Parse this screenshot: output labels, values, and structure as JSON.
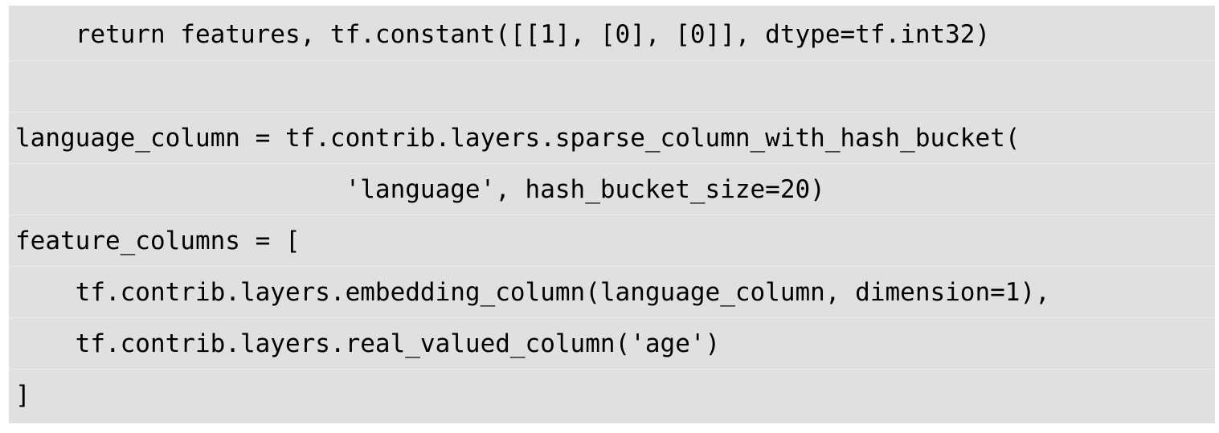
{
  "code": {
    "lines": [
      "    return features, tf.constant([[1], [0], [0]], dtype=tf.int32)",
      "",
      "language_column = tf.contrib.layers.sparse_column_with_hash_bucket(",
      "                      'language', hash_bucket_size=20)",
      "feature_columns = [",
      "    tf.contrib.layers.embedding_column(language_column, dimension=1),",
      "    tf.contrib.layers.real_valued_column('age')",
      "]"
    ]
  }
}
